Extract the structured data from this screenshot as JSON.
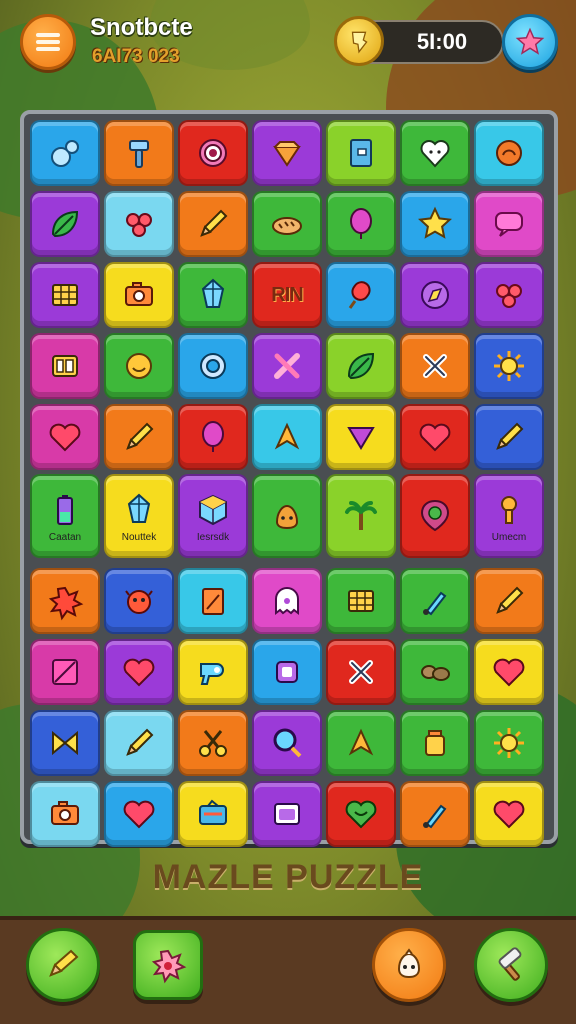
{
  "header": {
    "title": "Snotbcte",
    "subtitle": "6AI73 023",
    "coins": "5I:00"
  },
  "game_title": "MAZLE PUZZLE",
  "colors": {
    "blue": "#2aa6ea",
    "orange": "#f27a1a",
    "red": "#e0281e",
    "purple": "#9b3ad8",
    "lime": "#8ad22a",
    "cyan": "#38c8e8",
    "yellow": "#f6dc1e",
    "pink": "#e04ac8",
    "green": "#3eb83a",
    "magenta": "#d83aa8",
    "navy": "#3460d8",
    "sky": "#7ad8f0"
  },
  "board": {
    "rows_top": [
      [
        {
          "c": "blue",
          "i": "bubbles-icon"
        },
        {
          "c": "orange",
          "i": "hammer-icon"
        },
        {
          "c": "red",
          "i": "target-icon"
        },
        {
          "c": "purple",
          "i": "diamond-icon"
        },
        {
          "c": "lime",
          "i": "book-icon"
        },
        {
          "c": "green",
          "i": "heart-face-icon"
        },
        {
          "c": "cyan",
          "i": "shell-icon"
        }
      ],
      [
        {
          "c": "purple",
          "i": "leaf-icon"
        },
        {
          "c": "sky",
          "i": "flower-icon"
        },
        {
          "c": "orange",
          "i": "pencil-icon"
        },
        {
          "c": "green",
          "i": "bread-icon"
        },
        {
          "c": "green",
          "i": "balloon-icon"
        },
        {
          "c": "blue",
          "i": "star-icon"
        },
        {
          "c": "pink",
          "i": "speech-bubble-icon"
        }
      ],
      [
        {
          "c": "purple",
          "i": "grid-icon"
        },
        {
          "c": "yellow",
          "i": "camera-icon"
        },
        {
          "c": "green",
          "i": "crystal-icon"
        },
        {
          "c": "red",
          "i": "text-tile",
          "t": "RIN"
        },
        {
          "c": "blue",
          "i": "popsicle-icon"
        },
        {
          "c": "purple",
          "i": "compass-icon"
        },
        {
          "c": "purple",
          "i": "flower-icon"
        }
      ],
      [
        {
          "c": "magenta",
          "i": "dice-icon"
        },
        {
          "c": "green",
          "i": "smiley-icon"
        },
        {
          "c": "blue",
          "i": "ring-icon"
        },
        {
          "c": "purple",
          "i": "tools-icon"
        },
        {
          "c": "lime",
          "i": "leaf-icon"
        },
        {
          "c": "orange",
          "i": "cross-icon"
        },
        {
          "c": "navy",
          "i": "sun-icon"
        }
      ],
      [
        {
          "c": "magenta",
          "i": "heart-icon"
        },
        {
          "c": "orange",
          "i": "pencil-icon"
        },
        {
          "c": "red",
          "i": "balloon-icon"
        },
        {
          "c": "cyan",
          "i": "arrow-icon"
        },
        {
          "c": "yellow",
          "i": "triangle-icon"
        },
        {
          "c": "red",
          "i": "heart-icon"
        },
        {
          "c": "navy",
          "i": "pencil-icon"
        }
      ]
    ],
    "row_labeled": [
      {
        "c": "green",
        "i": "battery-icon",
        "cap": "Caatan"
      },
      {
        "c": "yellow",
        "i": "crystal-icon",
        "cap": "Nouttek"
      },
      {
        "c": "purple",
        "i": "cube-icon",
        "cap": "Iesrsdk"
      },
      {
        "c": "green",
        "i": "creature-icon",
        "cap": ""
      },
      {
        "c": "lime",
        "i": "palm-tree-icon",
        "cap": ""
      },
      {
        "c": "red",
        "i": "badge-icon",
        "cap": ""
      },
      {
        "c": "purple",
        "i": "key-icon",
        "cap": "Umecm"
      }
    ],
    "rows_bottom": [
      [
        {
          "c": "orange",
          "i": "splat-icon"
        },
        {
          "c": "navy",
          "i": "monster-icon"
        },
        {
          "c": "cyan",
          "i": "notepad-icon"
        },
        {
          "c": "pink",
          "i": "ghost-icon"
        },
        {
          "c": "green",
          "i": "grid-icon"
        },
        {
          "c": "green",
          "i": "brush-icon"
        },
        {
          "c": "orange",
          "i": "pencil-icon"
        }
      ],
      [
        {
          "c": "magenta",
          "i": "slash-icon"
        },
        {
          "c": "purple",
          "i": "heart-icon"
        },
        {
          "c": "yellow",
          "i": "hairdryer-icon"
        },
        {
          "c": "blue",
          "i": "square-icon"
        },
        {
          "c": "red",
          "i": "cross-icon"
        },
        {
          "c": "green",
          "i": "stones-icon"
        },
        {
          "c": "yellow",
          "i": "heart-icon"
        }
      ],
      [
        {
          "c": "navy",
          "i": "bow-icon"
        },
        {
          "c": "sky",
          "i": "pencil-icon"
        },
        {
          "c": "orange",
          "i": "scissors-icon"
        },
        {
          "c": "purple",
          "i": "magnifier-icon"
        },
        {
          "c": "green",
          "i": "arrow-icon"
        },
        {
          "c": "green",
          "i": "jar-icon"
        },
        {
          "c": "green",
          "i": "sun-icon"
        }
      ],
      [
        {
          "c": "sky",
          "i": "camera-icon"
        },
        {
          "c": "blue",
          "i": "heart-icon"
        },
        {
          "c": "yellow",
          "i": "radio-icon"
        },
        {
          "c": "purple",
          "i": "tv-icon"
        },
        {
          "c": "red",
          "i": "heart-leaf-icon"
        },
        {
          "c": "orange",
          "i": "brush-icon"
        },
        {
          "c": "yellow",
          "i": "heart-icon"
        }
      ]
    ]
  },
  "bottom_buttons": [
    {
      "name": "pencil-booster-button",
      "icon": "pencil-icon"
    },
    {
      "name": "bomb-booster-button",
      "icon": "splat-icon"
    },
    {
      "name": "character-button",
      "icon": "creature-icon"
    },
    {
      "name": "hammer-booster-button",
      "icon": "hammer-icon"
    }
  ]
}
